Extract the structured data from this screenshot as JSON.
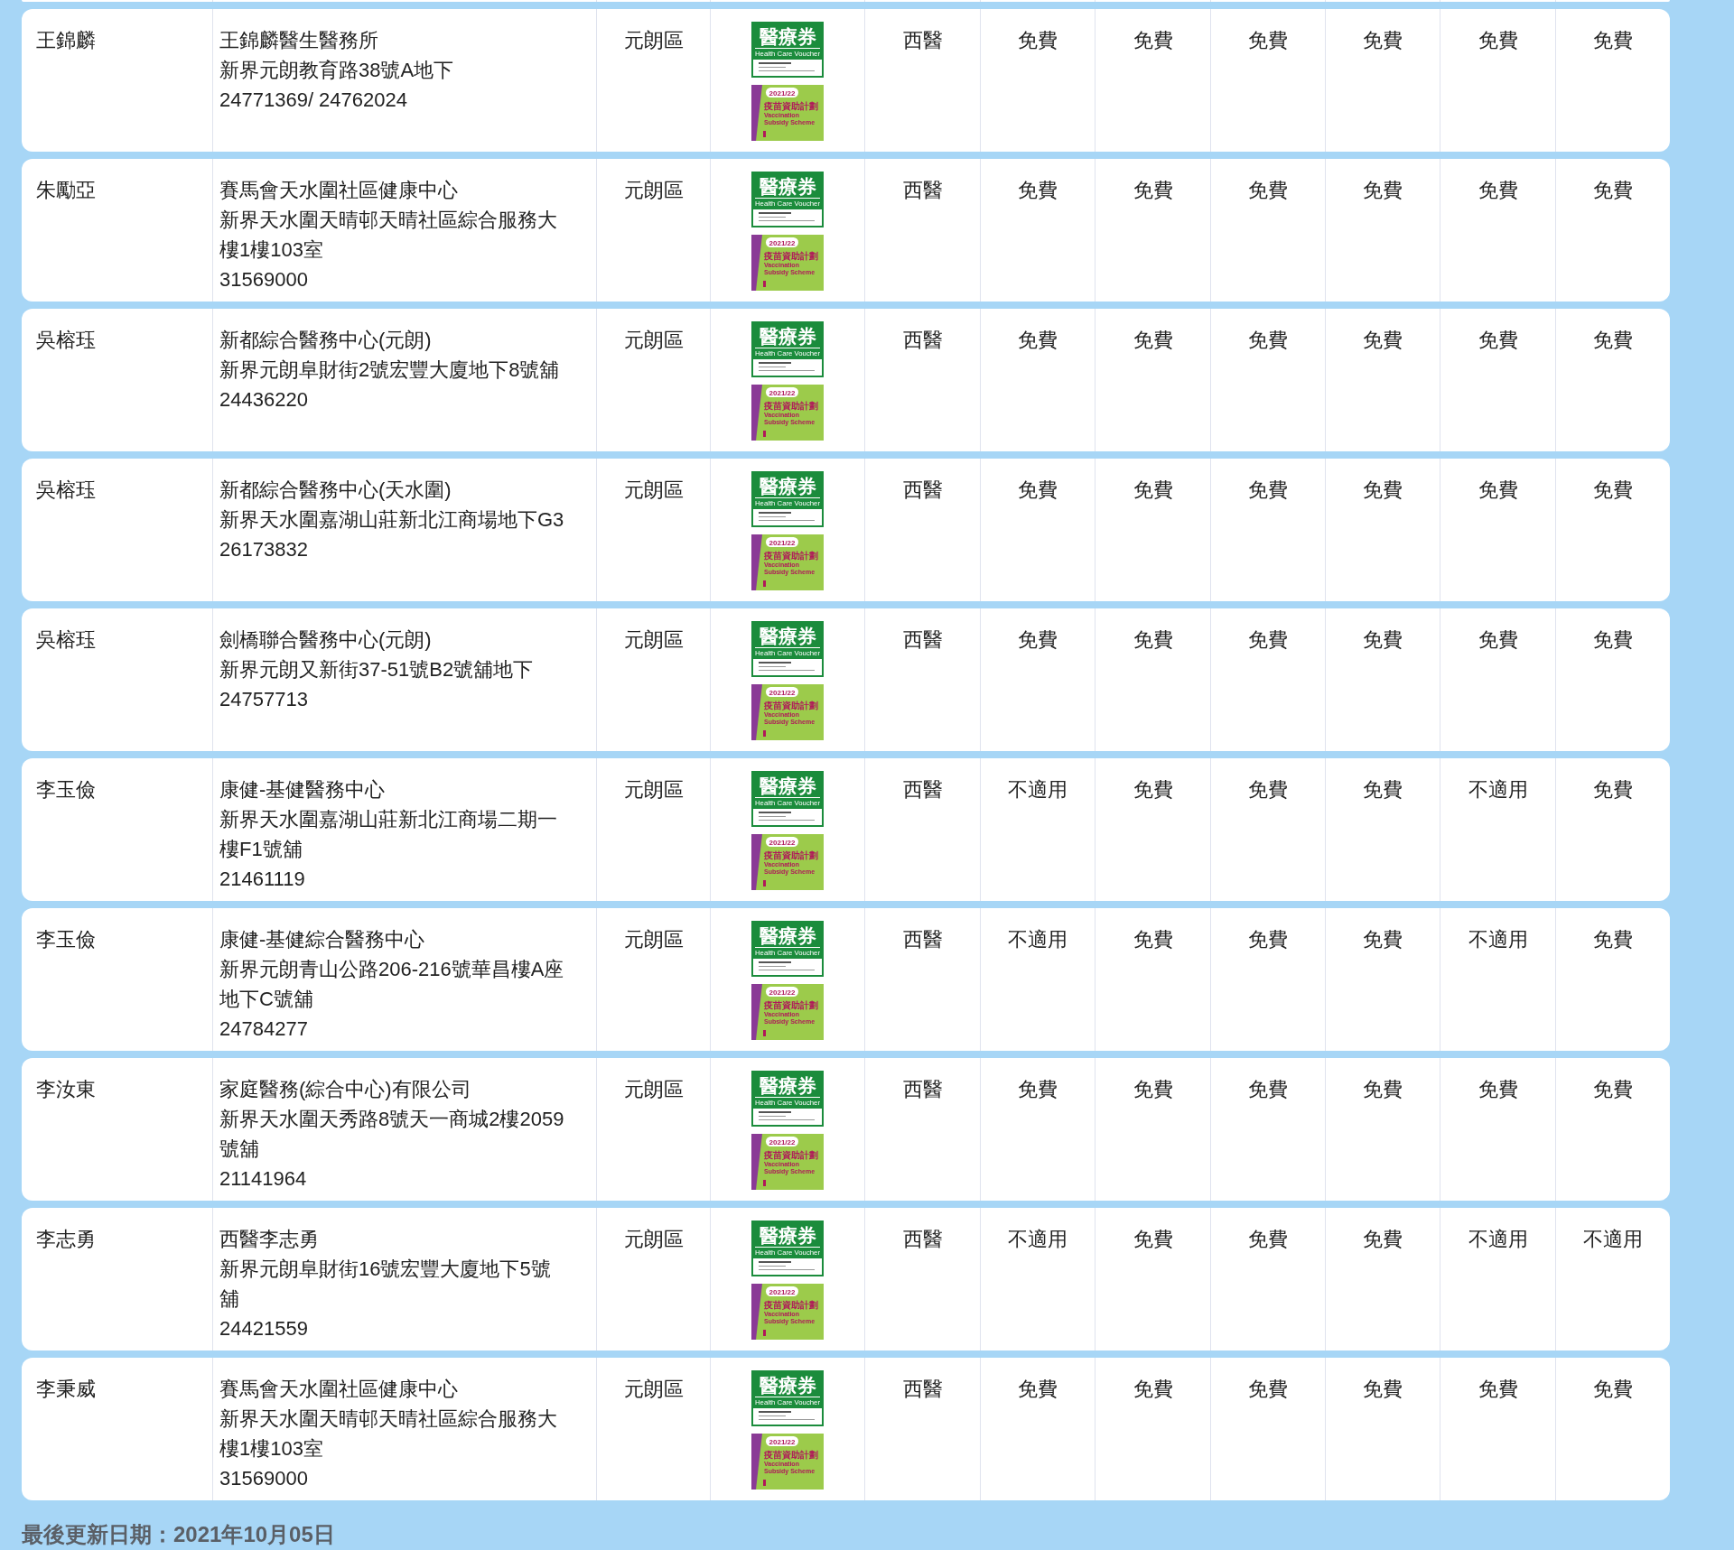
{
  "rows": [
    {
      "name": "王錦麟",
      "clinic": "王錦麟醫生醫務所",
      "address": "新界元朗教育路38號A地下",
      "phone": "24771369/ 24762024",
      "district": "元朗區",
      "voucher": {
        "title": "醫療券",
        "subtitle": "Health Care Voucher"
      },
      "vaccine": {
        "year": "2021/22",
        "title": "疫苗資助計劃",
        "line1": "Vaccination",
        "line2": "Subsidy Scheme"
      },
      "values": [
        "西醫",
        "免費",
        "免費",
        "免費",
        "免費",
        "免費",
        "免費"
      ]
    },
    {
      "name": "朱勵亞",
      "clinic": "賽馬會天水圍社區健康中心",
      "address": "新界天水圍天晴邨天晴社區綜合服務大樓1樓103室",
      "phone": "31569000",
      "district": "元朗區",
      "voucher": {
        "title": "醫療券",
        "subtitle": "Health Care Voucher"
      },
      "vaccine": {
        "year": "2021/22",
        "title": "疫苗資助計劃",
        "line1": "Vaccination",
        "line2": "Subsidy Scheme"
      },
      "values": [
        "西醫",
        "免費",
        "免費",
        "免費",
        "免費",
        "免費",
        "免費"
      ]
    },
    {
      "name": "吳榕珏",
      "clinic": "新都綜合醫務中心(元朗)",
      "address": "新界元朗阜財街2號宏豐大廈地下8號舖",
      "phone": "24436220",
      "district": "元朗區",
      "voucher": {
        "title": "醫療券",
        "subtitle": "Health Care Voucher"
      },
      "vaccine": {
        "year": "2021/22",
        "title": "疫苗資助計劃",
        "line1": "Vaccination",
        "line2": "Subsidy Scheme"
      },
      "values": [
        "西醫",
        "免費",
        "免費",
        "免費",
        "免費",
        "免費",
        "免費"
      ]
    },
    {
      "name": "吳榕珏",
      "clinic": "新都綜合醫務中心(天水圍)",
      "address": "新界天水圍嘉湖山莊新北江商場地下G3",
      "phone": "26173832",
      "district": "元朗區",
      "voucher": {
        "title": "醫療券",
        "subtitle": "Health Care Voucher"
      },
      "vaccine": {
        "year": "2021/22",
        "title": "疫苗資助計劃",
        "line1": "Vaccination",
        "line2": "Subsidy Scheme"
      },
      "values": [
        "西醫",
        "免費",
        "免費",
        "免費",
        "免費",
        "免費",
        "免費"
      ]
    },
    {
      "name": "吳榕珏",
      "clinic": "劍橋聯合醫務中心(元朗)",
      "address": "新界元朗又新街37-51號B2號舖地下",
      "phone": "24757713",
      "district": "元朗區",
      "voucher": {
        "title": "醫療券",
        "subtitle": "Health Care Voucher"
      },
      "vaccine": {
        "year": "2021/22",
        "title": "疫苗資助計劃",
        "line1": "Vaccination",
        "line2": "Subsidy Scheme"
      },
      "values": [
        "西醫",
        "免費",
        "免費",
        "免費",
        "免費",
        "免費",
        "免費"
      ]
    },
    {
      "name": "李玉儉",
      "clinic": "康健-基健醫務中心",
      "address": "新界天水圍嘉湖山莊新北江商場二期一樓F1號舖",
      "phone": "21461119",
      "district": "元朗區",
      "voucher": {
        "title": "醫療券",
        "subtitle": "Health Care Voucher"
      },
      "vaccine": {
        "year": "2021/22",
        "title": "疫苗資助計劃",
        "line1": "Vaccination",
        "line2": "Subsidy Scheme"
      },
      "values": [
        "西醫",
        "不適用",
        "免費",
        "免費",
        "免費",
        "不適用",
        "免費"
      ]
    },
    {
      "name": "李玉儉",
      "clinic": "康健-基健綜合醫務中心",
      "address": "新界元朗青山公路206-216號華昌樓A座地下C號舖",
      "phone": "24784277",
      "district": "元朗區",
      "voucher": {
        "title": "醫療券",
        "subtitle": "Health Care Voucher"
      },
      "vaccine": {
        "year": "2021/22",
        "title": "疫苗資助計劃",
        "line1": "Vaccination",
        "line2": "Subsidy Scheme"
      },
      "values": [
        "西醫",
        "不適用",
        "免費",
        "免費",
        "免費",
        "不適用",
        "免費"
      ]
    },
    {
      "name": "李汝東",
      "clinic": "家庭醫務(綜合中心)有限公司",
      "address": "新界天水圍天秀路8號天一商城2樓2059號舖",
      "phone": "21141964",
      "district": "元朗區",
      "voucher": {
        "title": "醫療券",
        "subtitle": "Health Care Voucher"
      },
      "vaccine": {
        "year": "2021/22",
        "title": "疫苗資助計劃",
        "line1": "Vaccination",
        "line2": "Subsidy Scheme"
      },
      "values": [
        "西醫",
        "免費",
        "免費",
        "免費",
        "免費",
        "免費",
        "免費"
      ]
    },
    {
      "name": "李志勇",
      "clinic": "西醫李志勇",
      "address": "新界元朗阜財街16號宏豐大廈地下5號舖",
      "phone": "24421559",
      "district": "元朗區",
      "voucher": {
        "title": "醫療券",
        "subtitle": "Health Care Voucher"
      },
      "vaccine": {
        "year": "2021/22",
        "title": "疫苗資助計劃",
        "line1": "Vaccination",
        "line2": "Subsidy Scheme"
      },
      "values": [
        "西醫",
        "不適用",
        "免費",
        "免費",
        "免費",
        "不適用",
        "不適用"
      ]
    },
    {
      "name": "李秉威",
      "clinic": "賽馬會天水圍社區健康中心",
      "address": "新界天水圍天晴邨天晴社區綜合服務大樓1樓103室",
      "phone": "31569000",
      "district": "元朗區",
      "voucher": {
        "title": "醫療券",
        "subtitle": "Health Care Voucher"
      },
      "vaccine": {
        "year": "2021/22",
        "title": "疫苗資助計劃",
        "line1": "Vaccination",
        "line2": "Subsidy Scheme"
      },
      "values": [
        "西醫",
        "免費",
        "免費",
        "免費",
        "免費",
        "免費",
        "免費"
      ]
    }
  ],
  "footer": "最後更新日期：2021年10月05日"
}
